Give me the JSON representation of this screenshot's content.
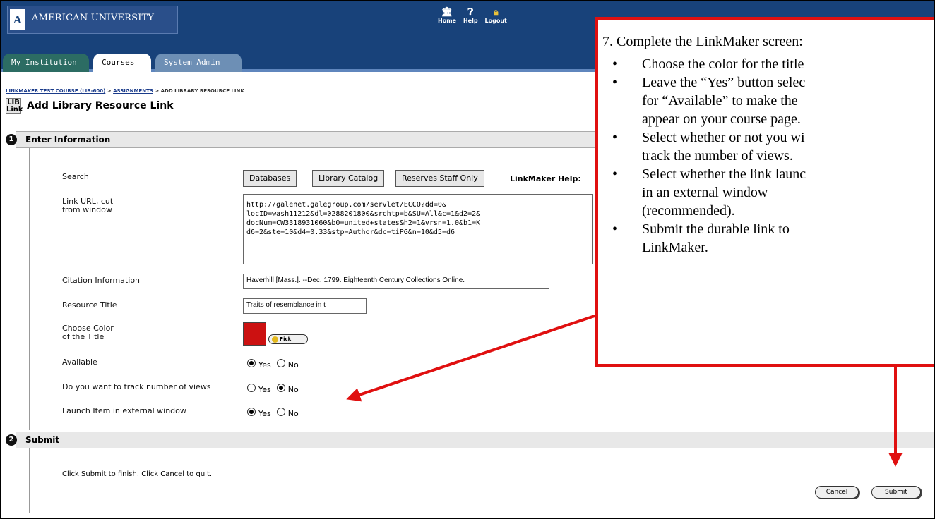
{
  "header": {
    "logo_mark": "A",
    "logo_text": "AMERICAN UNIVERSITY",
    "nav": [
      {
        "label": "Home",
        "icon": "home-icon"
      },
      {
        "label": "Help",
        "icon": "help-icon"
      },
      {
        "label": "Logout",
        "icon": "lock-icon"
      }
    ]
  },
  "tabs": [
    {
      "label": "My Institution"
    },
    {
      "label": "Courses"
    },
    {
      "label": "System Admin"
    }
  ],
  "breadcrumb": {
    "course": "LINKMAKER TEST COURSE (LIB-600)",
    "section": "ASSIGNMENTS",
    "current": "ADD LIBRARY RESOURCE LINK",
    "separator": ">"
  },
  "page": {
    "icon_text": "LIB Link",
    "title": "Add Library Resource Link"
  },
  "sections": {
    "enter_info": {
      "number": "1",
      "title": "Enter Information"
    },
    "submit": {
      "number": "2",
      "title": "Submit"
    }
  },
  "form": {
    "search_label": "Search",
    "search_buttons": [
      "Databases",
      "Library Catalog",
      "Reserves Staff Only"
    ],
    "help_label": "LinkMaker Help:",
    "url_label": "Link URL, cut\nfrom window",
    "url_value": "http://galenet.galegroup.com/servlet/ECCO?dd=0&\nlocID=wash11212&dl=0288201800&srchtp=b&SU=All&c=1&d2=2&\ndocNum=CW3318931060&b0=united+states&h2=1&vrsn=1.0&b1=K\nd6=2&ste=10&d4=0.33&stp=Author&dc=tiPG&n=10&d5=d6",
    "citation_label": "Citation Information",
    "citation_value": "Haverhill [Mass.]. --Dec. 1799. Eighteenth Century Collections Online.",
    "title_label": "Resource Title",
    "title_value": "Traits of resemblance in t",
    "color_label": "Choose Color\nof the Title",
    "color_value": "#cc1111",
    "pick_label": "Pick",
    "available_label": "Available",
    "track_label": "Do you want to track number of views",
    "launch_label": "Launch Item in external window",
    "yes": "Yes",
    "no": "No",
    "available": "Yes",
    "track": "No",
    "launch": "Yes"
  },
  "submit_section": {
    "text": "Click Submit to finish. Click Cancel to quit.",
    "cancel_label": "Cancel",
    "submit_label": "Submit"
  },
  "callout": {
    "heading": "7. Complete the LinkMaker screen:",
    "bullets": [
      "Choose the color for the title",
      "Leave the “Yes” button selec\nfor “Available” to make the\nappear on your course page.",
      "Select whether or not you wi\ntrack the number of views.",
      "Select whether the link launc\nin an external window\n(recommended).",
      "Submit the durable link to\nLinkMaker."
    ],
    "color": "#e01010"
  }
}
